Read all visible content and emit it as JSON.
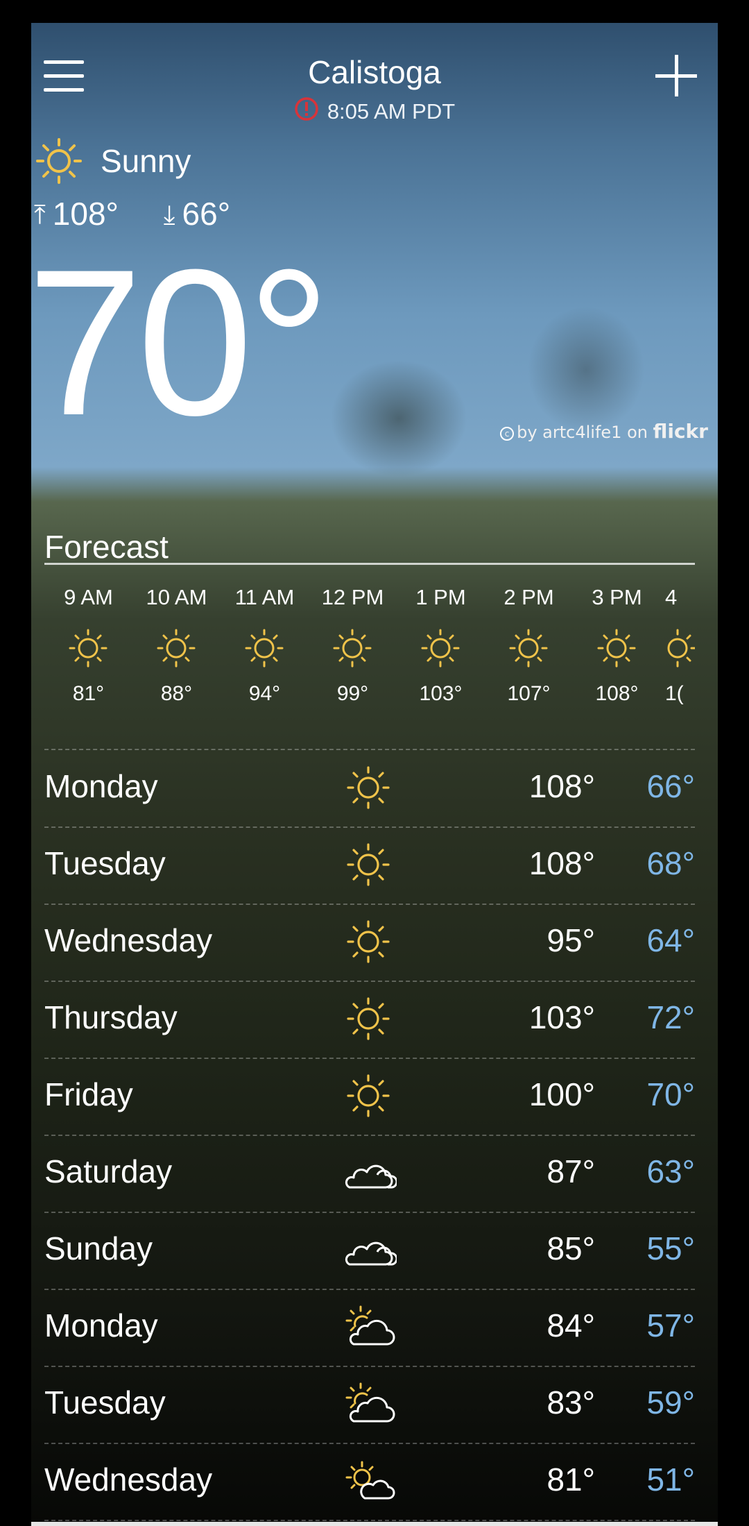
{
  "header": {
    "city": "Calistoga",
    "time": "8:05 AM PDT"
  },
  "current": {
    "condition": "Sunny",
    "condition_icon": "sun-icon",
    "high": "108°",
    "low": "66°",
    "temp": "70°",
    "photo_credit_prefix": "by artc4life1 on",
    "photo_credit_brand": "flickr"
  },
  "forecast": {
    "title": "Forecast",
    "hourly": [
      {
        "time": "9 AM",
        "icon": "sun-icon",
        "temp": "81°"
      },
      {
        "time": "10 AM",
        "icon": "sun-icon",
        "temp": "88°"
      },
      {
        "time": "11 AM",
        "icon": "sun-icon",
        "temp": "94°"
      },
      {
        "time": "12 PM",
        "icon": "sun-icon",
        "temp": "99°"
      },
      {
        "time": "1 PM",
        "icon": "sun-icon",
        "temp": "103°"
      },
      {
        "time": "2 PM",
        "icon": "sun-icon",
        "temp": "107°"
      },
      {
        "time": "3 PM",
        "icon": "sun-icon",
        "temp": "108°"
      },
      {
        "time": "4",
        "icon": "sun-icon",
        "temp": "1("
      }
    ],
    "daily": [
      {
        "day": "Monday",
        "icon": "sun-icon",
        "high": "108°",
        "low": "66°"
      },
      {
        "day": "Tuesday",
        "icon": "sun-icon",
        "high": "108°",
        "low": "68°"
      },
      {
        "day": "Wednesday",
        "icon": "sun-icon",
        "high": "95°",
        "low": "64°"
      },
      {
        "day": "Thursday",
        "icon": "sun-icon",
        "high": "103°",
        "low": "72°"
      },
      {
        "day": "Friday",
        "icon": "sun-icon",
        "high": "100°",
        "low": "70°"
      },
      {
        "day": "Saturday",
        "icon": "cloudy-icon",
        "high": "87°",
        "low": "63°"
      },
      {
        "day": "Sunday",
        "icon": "cloudy-icon",
        "high": "85°",
        "low": "55°"
      },
      {
        "day": "Monday",
        "icon": "partly-cloudy-icon",
        "high": "84°",
        "low": "57°"
      },
      {
        "day": "Tuesday",
        "icon": "partly-cloudy-icon",
        "high": "83°",
        "low": "59°"
      },
      {
        "day": "Wednesday",
        "icon": "partly-cloudy-icon",
        "high": "81°",
        "low": "51°"
      }
    ]
  },
  "colors": {
    "sun": "#f0c34a",
    "low_temp": "#7fb6e6",
    "alert": "#d8343a"
  }
}
